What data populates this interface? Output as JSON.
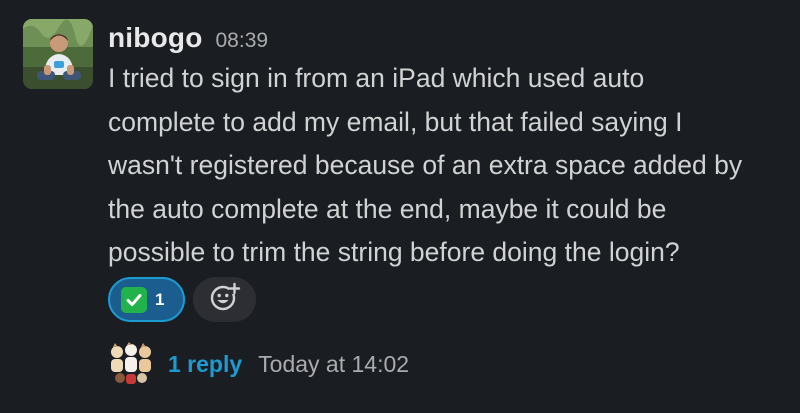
{
  "message": {
    "author": "nibogo",
    "time": "08:39",
    "lines": [
      "I tried to sign in from an iPad which used auto",
      "complete to add my email, but that failed saying I",
      "wasn't registered because of an extra space added by",
      "the auto complete at the end, maybe it could be",
      "possible to trim the string before doing the login?"
    ]
  },
  "reactions": [
    {
      "emoji_icon": "white-check-mark",
      "count": "1"
    }
  ],
  "add_reaction_icon": "add-emoji",
  "thread": {
    "reply_label": "1 reply",
    "last_reply": "Today at 14:02"
  },
  "colors": {
    "background": "#1a1d21",
    "link": "#1d9bd1",
    "reaction_bg": "#1b5d8f"
  }
}
